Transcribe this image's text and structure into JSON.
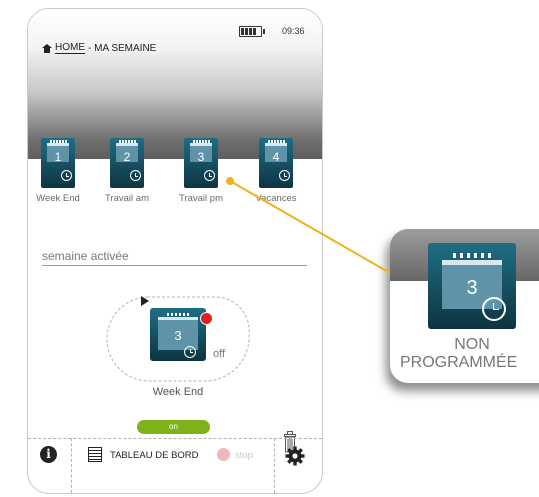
{
  "status_bar": {
    "time": "09:36"
  },
  "breadcrumb": {
    "home_label": "HOME",
    "page_label": "- MA SEMAINE"
  },
  "tiles": [
    {
      "number": "1",
      "label": "Week End"
    },
    {
      "number": "2",
      "label": "Travail am"
    },
    {
      "number": "3",
      "label": "Travail pm"
    },
    {
      "number": "4",
      "label": "Vacances"
    }
  ],
  "active_week": {
    "section_label": "semaine activée",
    "program_number": "3",
    "state_label": "off",
    "program_name": "Week End",
    "toggle_label": "on"
  },
  "footer": {
    "dashboard_label": "TABLEAU DE BORD",
    "stop_label": "stop"
  },
  "zoom_callout": {
    "number": "3",
    "line1": "NON",
    "line2": "PROGRAMMÉE"
  },
  "colors": {
    "tile_dark": "#0d3441",
    "tile_light": "#1f6e84",
    "toggle_on": "#7fb21a",
    "alert_red": "#e02020",
    "connector": "#f0b21a"
  }
}
